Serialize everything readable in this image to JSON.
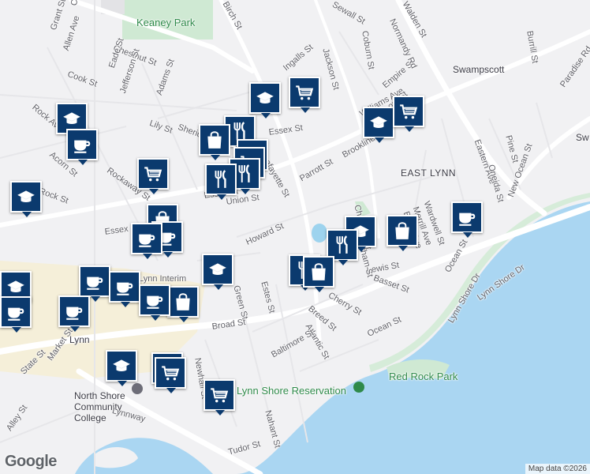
{
  "map": {
    "brand": "Google",
    "attribution": "Map data ©2026",
    "place_labels": [
      {
        "id": "east-lynn",
        "text": "EAST LYNN"
      },
      {
        "id": "swampscott",
        "text": "Swampscott"
      },
      {
        "id": "lynn-station",
        "text": "Lynn"
      },
      {
        "id": "lynn-interim",
        "text": "Lynn Interim"
      },
      {
        "id": "sw",
        "text": "Sw"
      }
    ],
    "park_labels": [
      {
        "id": "keaney-park",
        "text": "Keaney Park"
      },
      {
        "id": "red-rock-park",
        "text": "Red Rock Park"
      },
      {
        "id": "lynn-shore-reservation",
        "text": "Lynn Shore Reservation"
      },
      {
        "id": "north-shore-cc",
        "text": "North Shore Community College"
      }
    ],
    "street_labels": [
      "Chestnut St",
      "Chestnut St",
      "Grant St",
      "Allen Ave",
      "Eade St",
      "Cook St",
      "Jefferson St",
      "Adams St",
      "Lily St",
      "Rock Ave",
      "Acorn St",
      "Rock St",
      "Rockaway St",
      "Essex St",
      "Essex St",
      "Essex St",
      "Union St",
      "Parrott St",
      "Brookline St",
      "Howard St",
      "Green St",
      "Estes St",
      "Broad St",
      "Lewis St",
      "Basset St",
      "Cherry St",
      "Breed St",
      "Atlantic St",
      "Ocean St",
      "Ocean St",
      "Baltimore St",
      "Market St",
      "State St",
      "Newhall St",
      "Nahant St",
      "Tudor St",
      "Lynnway",
      "Lynn Shore Dr",
      "Lynn Shore Dr",
      "Eastern Ave",
      "New Ocean St",
      "Pine St",
      "Oneida St",
      "Wardwell St",
      "Merrill Ave",
      "Burrill Ave",
      "Burrill St",
      "Coburn St",
      "Jackson St",
      "Ingalls St",
      "Sewall St",
      "Williams Ave",
      "Alley St",
      "Birch St",
      "Sheridan St",
      "Lafayette St",
      "Chatham St",
      "Chatham St",
      "Empire St",
      "Tremont St",
      "Normandy Rd",
      "Paradise Rd",
      "Walden St"
    ],
    "markers": [
      {
        "id": "school-1",
        "type": "school"
      },
      {
        "id": "grocery-1",
        "type": "grocery"
      },
      {
        "id": "school-2",
        "type": "school"
      },
      {
        "id": "cafe-1",
        "type": "cafe"
      },
      {
        "id": "grocery-2",
        "type": "grocery"
      },
      {
        "id": "school-3",
        "type": "school"
      },
      {
        "id": "restaurant-1",
        "type": "restaurant"
      },
      {
        "id": "shopping-1",
        "type": "shopping"
      },
      {
        "id": "grocery-3",
        "type": "grocery"
      },
      {
        "id": "grocery-4",
        "type": "grocery"
      },
      {
        "id": "school-4",
        "type": "school"
      },
      {
        "id": "grocery-5",
        "type": "grocery"
      },
      {
        "id": "restaurant-2",
        "type": "restaurant"
      },
      {
        "id": "restaurant-3",
        "type": "restaurant"
      },
      {
        "id": "shopping-2",
        "type": "shopping"
      },
      {
        "id": "cafe-2",
        "type": "cafe"
      },
      {
        "id": "school-5",
        "type": "school"
      },
      {
        "id": "school-6",
        "type": "school"
      },
      {
        "id": "restaurant-4",
        "type": "restaurant"
      },
      {
        "id": "shopping-3",
        "type": "shopping"
      },
      {
        "id": "cafe-3",
        "type": "cafe"
      },
      {
        "id": "school-7",
        "type": "school"
      },
      {
        "id": "restaurant-5",
        "type": "restaurant"
      },
      {
        "id": "shopping-4",
        "type": "shopping"
      },
      {
        "id": "cafe-4",
        "type": "cafe"
      },
      {
        "id": "cafe-5",
        "type": "cafe"
      },
      {
        "id": "cafe-6",
        "type": "cafe"
      },
      {
        "id": "shopping-5",
        "type": "shopping"
      },
      {
        "id": "cafe-7",
        "type": "cafe"
      },
      {
        "id": "cafe-8",
        "type": "cafe"
      },
      {
        "id": "school-8",
        "type": "school"
      },
      {
        "id": "grocery-6",
        "type": "grocery"
      },
      {
        "id": "grocery-7",
        "type": "grocery"
      },
      {
        "id": "grocery-8",
        "type": "grocery"
      },
      {
        "id": "cafe-9",
        "type": "cafe"
      }
    ]
  }
}
